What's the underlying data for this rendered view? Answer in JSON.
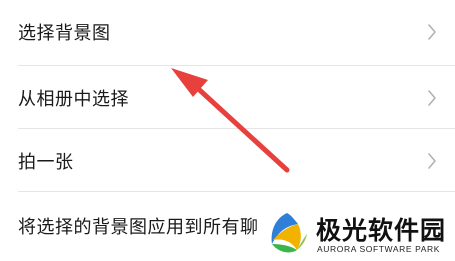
{
  "menu": {
    "items": [
      {
        "label": "选择背景图"
      },
      {
        "label": "从相册中选择"
      },
      {
        "label": "拍一张"
      },
      {
        "label": "将选择的背景图应用到所有聊天场景"
      }
    ]
  },
  "watermark": {
    "title": "极光软件园",
    "subtitle": "AURORA SOFTWARE PARK"
  },
  "colors": {
    "arrow": "#e8413d",
    "background": "#ffffff",
    "chevron": "#b2b2b2",
    "divider": "#e6e6e6"
  }
}
